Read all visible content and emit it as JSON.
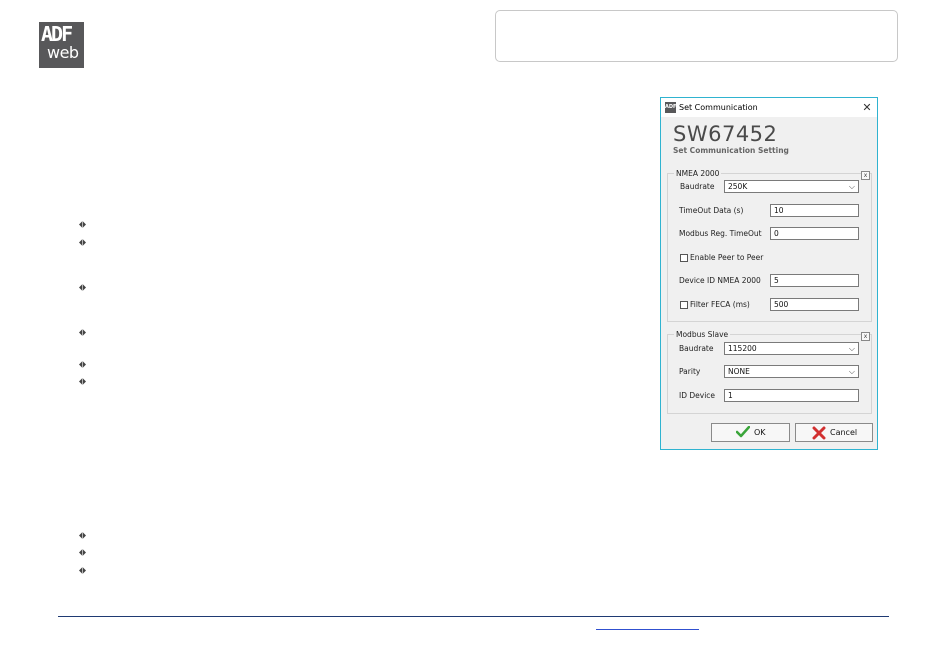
{
  "logo": {
    "line1": "ADF",
    "line2": "web"
  },
  "dialog": {
    "title": "Set Communication",
    "app_icon_text": "ADF",
    "heading": "SW67452",
    "subheading": "Set Communication Setting",
    "nmea": {
      "legend": "NMEA 2000",
      "baudrate_label": "Baudrate",
      "baudrate_value": "250K",
      "timeout_label": "TimeOut Data (s)",
      "timeout_value": "10",
      "modbus_timeout_label": "Modbus Reg. TimeOut",
      "modbus_timeout_value": "0",
      "peer_label": "Enable Peer to Peer",
      "device_id_label": "Device ID NMEA 2000",
      "device_id_value": "5",
      "feca_label": "Filter FECA (ms)",
      "feca_value": "500"
    },
    "modbus": {
      "legend": "Modbus Slave",
      "baudrate_label": "Baudrate",
      "baudrate_value": "115200",
      "parity_label": "Parity",
      "parity_value": "NONE",
      "id_label": "ID Device",
      "id_value": "1"
    },
    "ok_label": "OK",
    "cancel_label": "Cancel"
  }
}
